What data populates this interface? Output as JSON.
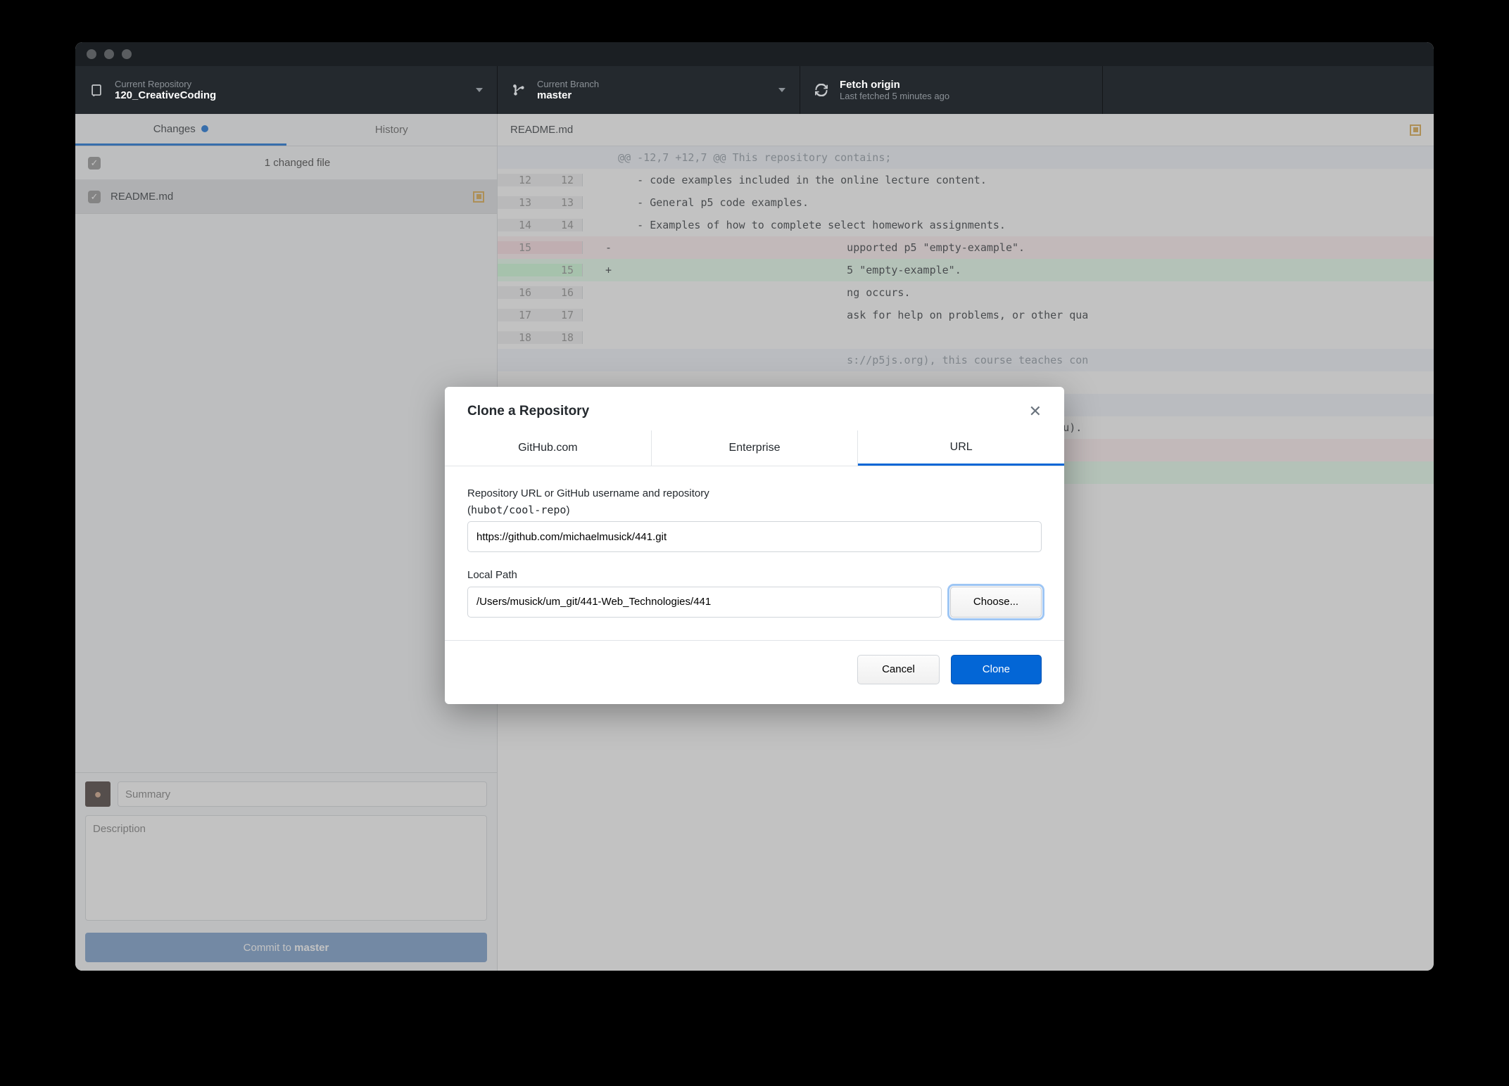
{
  "toolbar": {
    "repo": {
      "label": "Current Repository",
      "value": "120_CreativeCoding"
    },
    "branch": {
      "label": "Current Branch",
      "value": "master"
    },
    "fetch": {
      "action": "Fetch origin",
      "sub": "Last fetched 5 minutes ago"
    }
  },
  "sidebar": {
    "tabs": {
      "changes": "Changes",
      "history": "History"
    },
    "file_count": "1 changed file",
    "files": [
      {
        "name": "README.md"
      }
    ],
    "summary_placeholder": "Summary",
    "description_placeholder": "Description",
    "commit_prefix": "Commit to ",
    "commit_branch": "master"
  },
  "diff": {
    "filename": "README.md",
    "lines": [
      {
        "t": "hunk",
        "a": "",
        "b": "",
        "s": "",
        "c": "@@ -12,7 +12,7 @@ This repository contains;"
      },
      {
        "t": "ctx",
        "a": "12",
        "b": "12",
        "s": " ",
        "c": "   - code examples included in the online lecture content."
      },
      {
        "t": "ctx",
        "a": "13",
        "b": "13",
        "s": " ",
        "c": "   - General p5 code examples."
      },
      {
        "t": "ctx",
        "a": "14",
        "b": "14",
        "s": " ",
        "c": "   - Examples of how to complete select homework assignments."
      },
      {
        "t": "del",
        "a": "15",
        "b": "",
        "s": "-",
        "c": "                                    upported p5 \"empty-example\"."
      },
      {
        "t": "add",
        "a": "",
        "b": "15",
        "s": "+",
        "c": "                                    5 \"empty-example\"."
      },
      {
        "t": "ctx",
        "a": "16",
        "b": "16",
        "s": " ",
        "c": "                                    ng occurs."
      },
      {
        "t": "ctx",
        "a": "17",
        "b": "17",
        "s": " ",
        "c": "                                    ask for help on problems, or other qua"
      },
      {
        "t": "ctx",
        "a": "18",
        "b": "18",
        "s": " ",
        "c": ""
      },
      {
        "t": "hunk",
        "a": "",
        "b": "",
        "s": "",
        "c": "                                    s://p5js.org), this course teaches con"
      },
      {
        "t": "ctx",
        "a": "",
        "b": "",
        "s": " ",
        "c": ""
      },
      {
        "t": "hunk",
        "a": "",
        "b": "",
        "s": "",
        "c": ""
      },
      {
        "t": "ctx",
        "a": "",
        "b": "",
        "s": " ",
        "c": "                                    (mailto:michael.musick@umontana.edu)."
      },
      {
        "t": "del",
        "a": "",
        "b": "",
        "s": "-",
        "c": ""
      },
      {
        "t": "add",
        "a": "",
        "b": "",
        "s": "+",
        "c": ""
      }
    ]
  },
  "modal": {
    "title": "Clone a Repository",
    "tabs": [
      "GitHub.com",
      "Enterprise",
      "URL"
    ],
    "url_label_line1": "Repository URL or GitHub username and repository",
    "url_label_hint": "hubot/cool-repo",
    "url_value": "https://github.com/michaelmusick/441.git",
    "path_label": "Local Path",
    "path_value": "/Users/musick/um_git/441-Web_Technologies/441",
    "choose": "Choose...",
    "cancel": "Cancel",
    "clone": "Clone"
  }
}
